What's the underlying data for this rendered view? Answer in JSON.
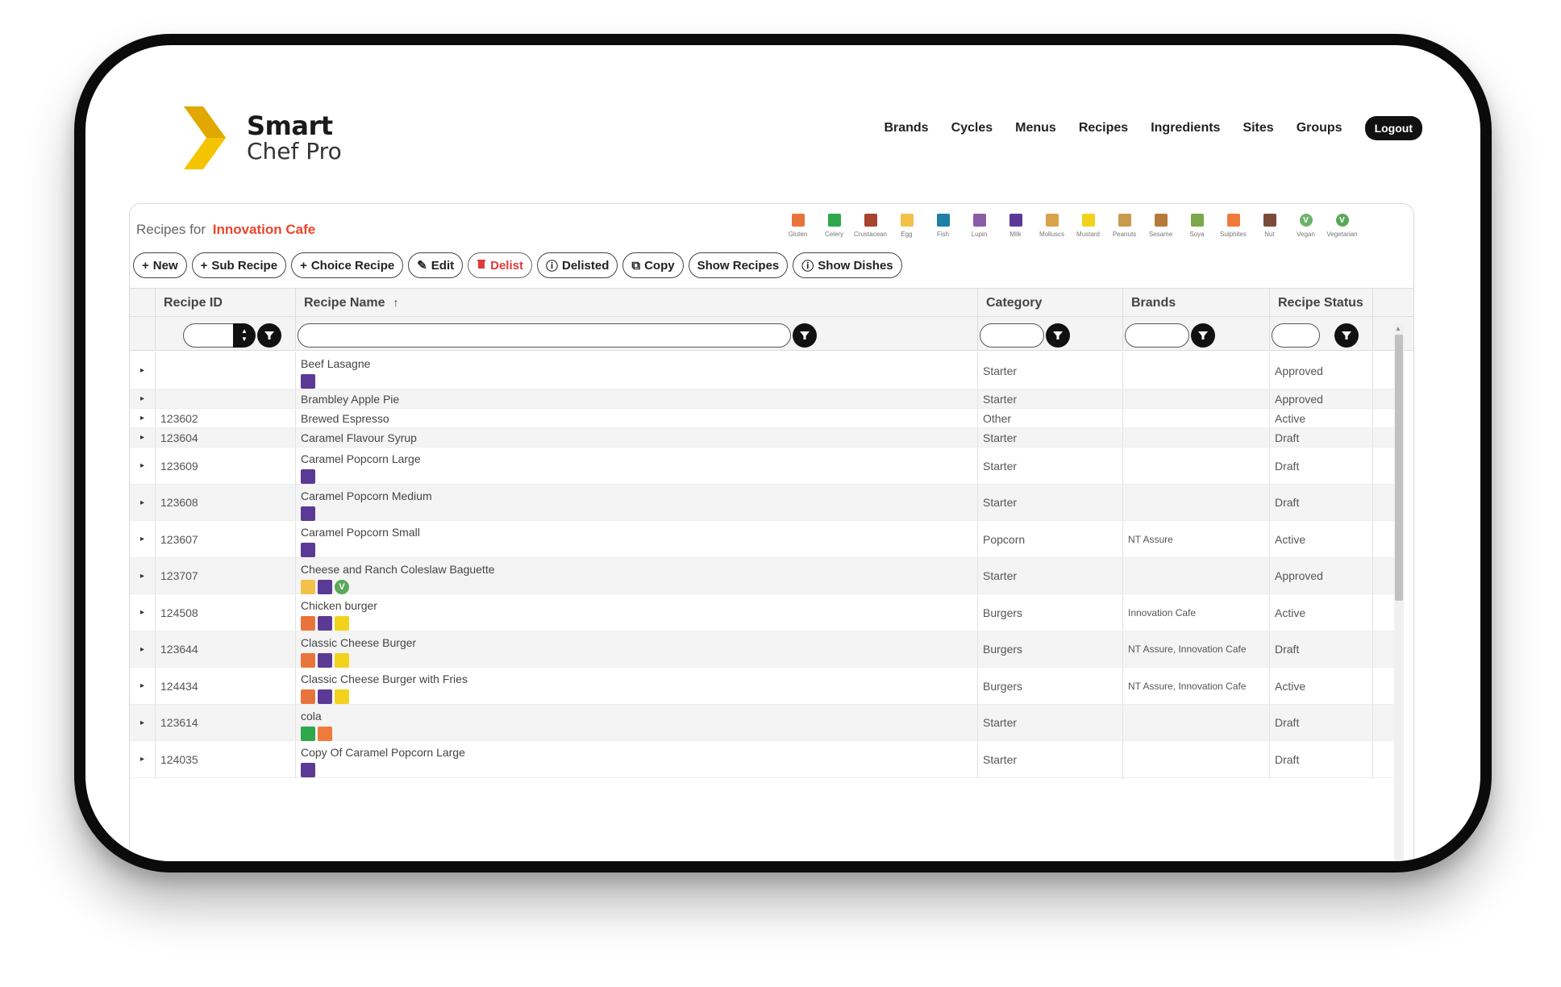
{
  "logo": {
    "line1": "Smart",
    "line2": "Chef Pro"
  },
  "nav": {
    "items": [
      "Brands",
      "Cycles",
      "Menus",
      "Recipes",
      "Ingredients",
      "Sites",
      "Groups"
    ],
    "logout": "Logout"
  },
  "panel": {
    "title_prefix": "Recipes for",
    "site": "Innovation Cafe"
  },
  "allergens": [
    {
      "label": "Gluten",
      "color": "#e8743b",
      "icon": "wheat-icon"
    },
    {
      "label": "Celery",
      "color": "#2ea84a",
      "icon": "celery-icon"
    },
    {
      "label": "Crustacean",
      "color": "#a8432f",
      "icon": "crab-icon"
    },
    {
      "label": "Egg",
      "color": "#f3c04a",
      "icon": "egg-icon"
    },
    {
      "label": "Fish",
      "color": "#1f7fa6",
      "icon": "fish-icon"
    },
    {
      "label": "Lupin",
      "color": "#8a5ca8",
      "icon": "lupin-icon"
    },
    {
      "label": "Milk",
      "color": "#5b3a95",
      "icon": "milk-icon"
    },
    {
      "label": "Molluscs",
      "color": "#d9a24d",
      "icon": "mollusc-icon"
    },
    {
      "label": "Mustard",
      "color": "#f2d21b",
      "icon": "mustard-icon"
    },
    {
      "label": "Peanuts",
      "color": "#c89a4e",
      "icon": "peanut-icon"
    },
    {
      "label": "Sesame",
      "color": "#b57a3a",
      "icon": "sesame-icon"
    },
    {
      "label": "Soya",
      "color": "#7aa84a",
      "icon": "soya-icon"
    },
    {
      "label": "Sulphites",
      "color": "#f07a3a",
      "icon": "sulphite-icon"
    },
    {
      "label": "Nut",
      "color": "#7a4a3a",
      "icon": "nut-icon"
    },
    {
      "label": "Vegan",
      "color": "#6db36d",
      "icon": "vegan-icon"
    },
    {
      "label": "Vegetarian",
      "color": "#5aa85a",
      "icon": "vegetarian-icon"
    }
  ],
  "toolbar": {
    "new": "New",
    "sub_recipe": "Sub Recipe",
    "choice_recipe": "Choice Recipe",
    "edit": "Edit",
    "delist": "Delist",
    "delisted": "Delisted",
    "copy": "Copy",
    "show_recipes": "Show Recipes",
    "show_dishes": "Show Dishes"
  },
  "columns": {
    "recipe_id": "Recipe ID",
    "recipe_name": "Recipe Name",
    "category": "Category",
    "brands": "Brands",
    "recipe_status": "Recipe Status"
  },
  "rows": [
    {
      "id": "",
      "name": "Beef Lasagne",
      "category": "Starter",
      "brands": "",
      "status": "Approved",
      "badges": [
        "milk"
      ],
      "h": 46
    },
    {
      "id": "",
      "name": "Brambley Apple Pie",
      "category": "Starter",
      "brands": "",
      "status": "Approved",
      "badges": [],
      "h": 24
    },
    {
      "id": "123602",
      "name": "Brewed Espresso",
      "category": "Other",
      "brands": "",
      "status": "Active",
      "badges": [],
      "h": 24
    },
    {
      "id": "123604",
      "name": "Caramel Flavour Syrup",
      "category": "Starter",
      "brands": "",
      "status": "Draft",
      "badges": [],
      "h": 24
    },
    {
      "id": "123609",
      "name": "Caramel Popcorn Large",
      "category": "Starter",
      "brands": "",
      "status": "Draft",
      "badges": [
        "milk"
      ],
      "h": 46
    },
    {
      "id": "123608",
      "name": "Caramel Popcorn Medium",
      "category": "Starter",
      "brands": "",
      "status": "Draft",
      "badges": [
        "milk"
      ],
      "h": 45
    },
    {
      "id": "123607",
      "name": "Caramel Popcorn Small",
      "category": "Popcorn",
      "brands": "NT Assure",
      "status": "Active",
      "badges": [
        "milk"
      ],
      "h": 46
    },
    {
      "id": "123707",
      "name": "Cheese and Ranch Coleslaw Baguette",
      "category": "Starter",
      "brands": "",
      "status": "Approved",
      "badges": [
        "egg",
        "milk",
        "vegetarian"
      ],
      "h": 45
    },
    {
      "id": "124508",
      "name": "Chicken burger",
      "category": "Burgers",
      "brands": "Innovation Cafe",
      "status": "Active",
      "badges": [
        "gluten",
        "milk",
        "mustard"
      ],
      "h": 46
    },
    {
      "id": "123644",
      "name": "Classic Cheese Burger",
      "category": "Burgers",
      "brands": "NT Assure, Innovation Cafe",
      "status": "Draft",
      "badges": [
        "gluten",
        "milk",
        "mustard"
      ],
      "h": 45
    },
    {
      "id": "124434",
      "name": "Classic Cheese Burger with Fries",
      "category": "Burgers",
      "brands": "NT Assure, Innovation Cafe",
      "status": "Active",
      "badges": [
        "gluten",
        "milk",
        "mustard"
      ],
      "h": 46
    },
    {
      "id": "123614",
      "name": "cola",
      "category": "Starter",
      "brands": "",
      "status": "Draft",
      "badges": [
        "celery",
        "sulphites"
      ],
      "h": 45
    },
    {
      "id": "124035",
      "name": "Copy Of Caramel Popcorn Large",
      "category": "Starter",
      "brands": "",
      "status": "Draft",
      "badges": [
        "milk"
      ],
      "h": 46
    }
  ],
  "badge_colors": {
    "milk": "#5b3a95",
    "egg": "#f3c04a",
    "vegetarian": "#5aa85a",
    "gluten": "#e8743b",
    "mustard": "#f2d21b",
    "celery": "#2ea84a",
    "sulphites": "#f07a3a"
  }
}
